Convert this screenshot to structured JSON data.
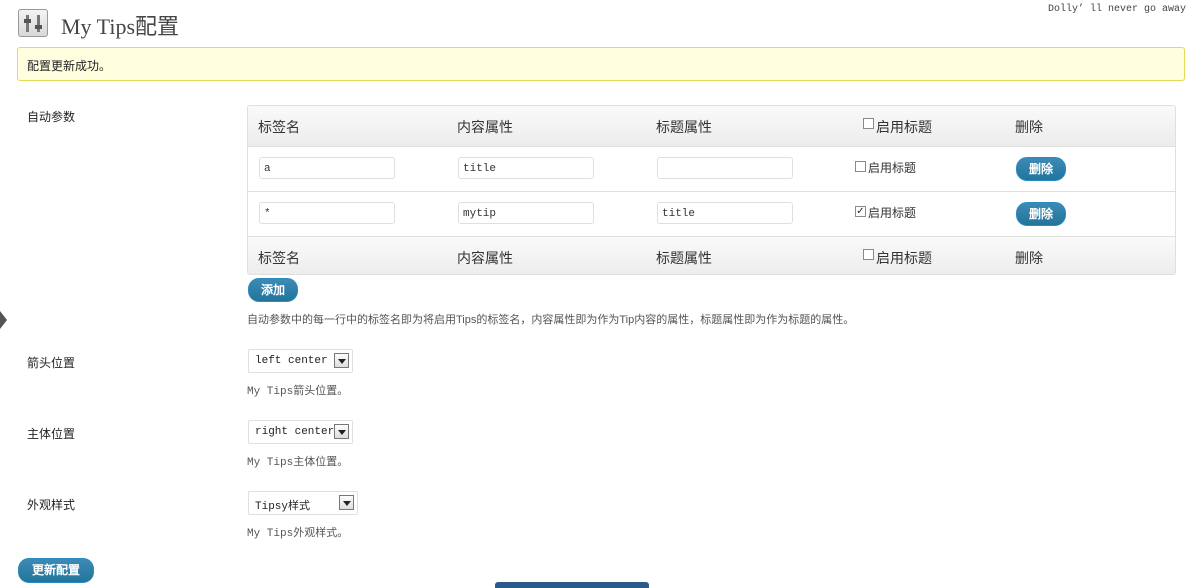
{
  "header": {
    "title": "My Tips配置",
    "dolly": "Dolly’ ll never go away"
  },
  "notice": {
    "text": "配置更新成功。"
  },
  "auto_params": {
    "label": "自动参数",
    "columns": [
      "标签名",
      "内容属性",
      "标题属性",
      "启用标题",
      "删除"
    ],
    "rows": [
      {
        "tag": "a",
        "content_attr": "title",
        "title_attr": "",
        "enable_title": false,
        "enable_label": "启用标题",
        "delete_label": "删除"
      },
      {
        "tag": "*",
        "content_attr": "mytip",
        "title_attr": "title",
        "enable_title": true,
        "enable_label": "启用标题",
        "delete_label": "删除"
      }
    ],
    "add_label": "添加",
    "description": "自动参数中的每一行中的标签名即为将启用Tips的标签名，内容属性即为作为Tip内容的属性，标题属性即为作为标题的属性。"
  },
  "arrow_position": {
    "label": "箭头位置",
    "value": "left center",
    "hint": "My Tips箭头位置。"
  },
  "body_position": {
    "label": "主体位置",
    "value": "right center",
    "hint": "My Tips主体位置。"
  },
  "appearance": {
    "label": "外观样式",
    "value": "Tipsy样式",
    "hint": "My Tips外观样式。"
  },
  "submit_label": "更新配置",
  "colors": {
    "button": "#21759b",
    "notice_bg": "#ffffe0",
    "notice_border": "#e6db55"
  }
}
